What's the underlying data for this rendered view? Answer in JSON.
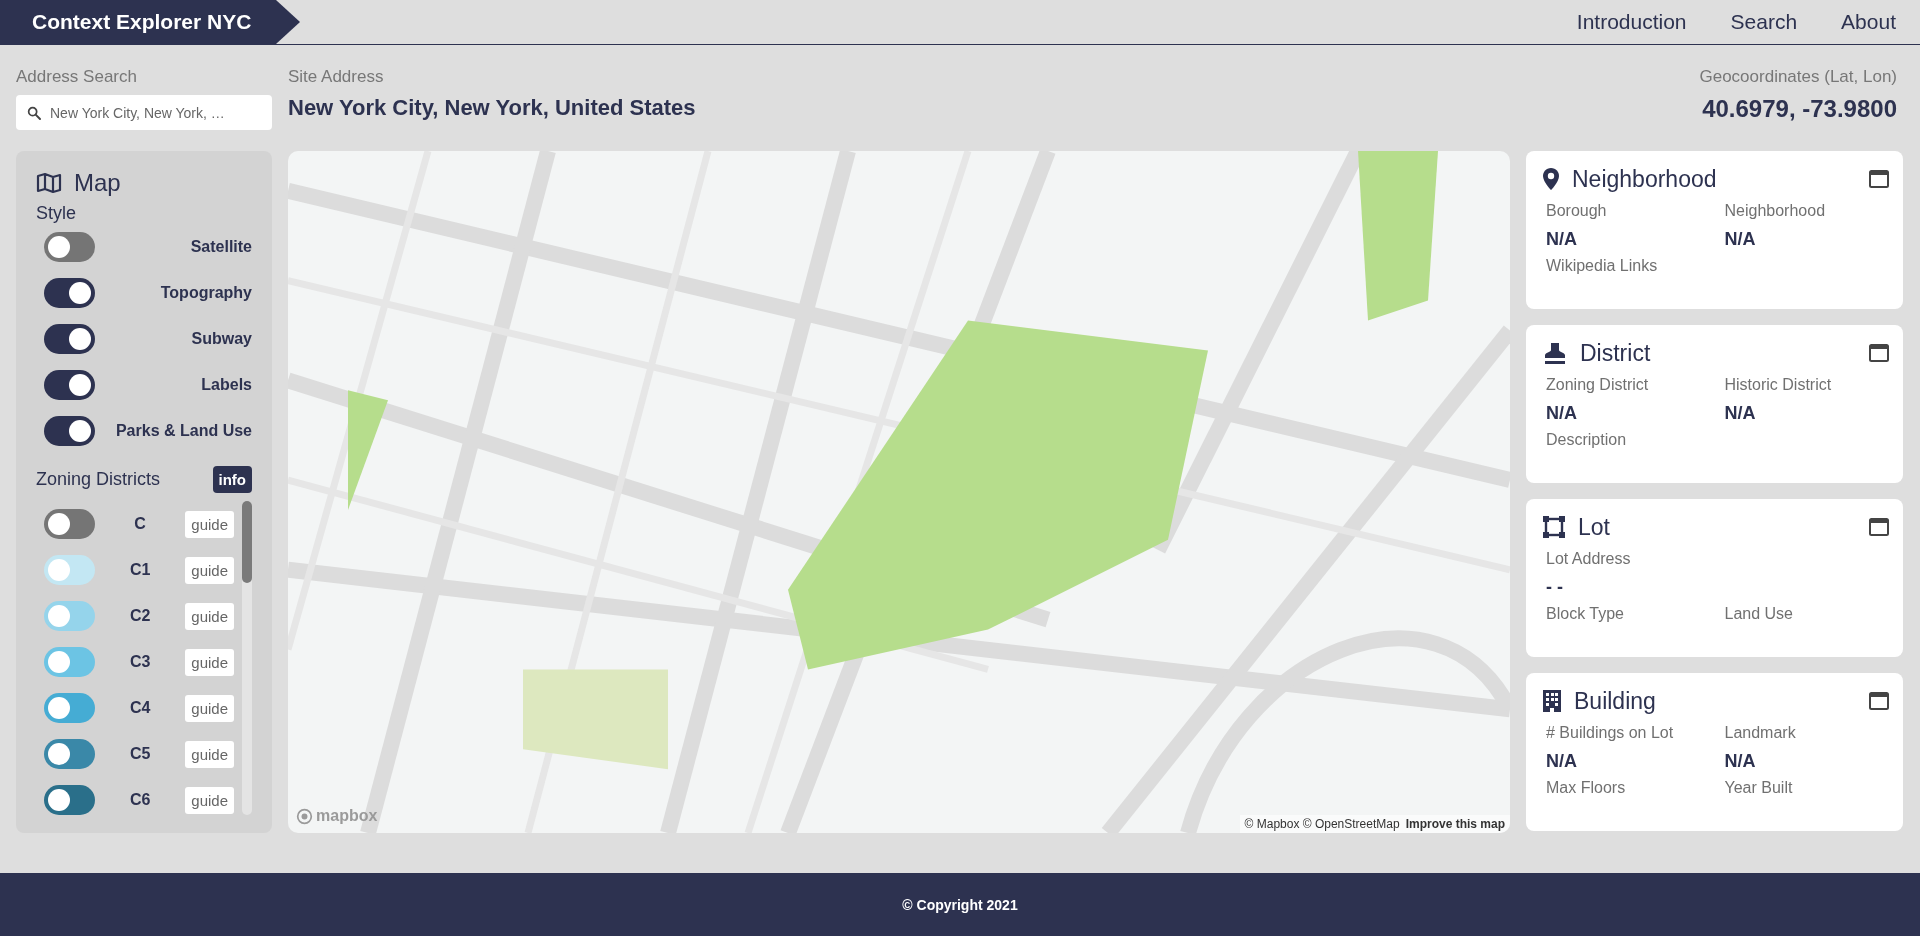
{
  "header": {
    "brand": "Context Explorer NYC",
    "nav": [
      {
        "label": "Introduction"
      },
      {
        "label": "Search"
      },
      {
        "label": "About"
      }
    ]
  },
  "address_search": {
    "label": "Address Search",
    "value": "New York City, New York, …"
  },
  "site_address": {
    "label": "Site Address",
    "value": "New York City, New York, United States"
  },
  "geocoordinates": {
    "label": "Geocoordinates (Lat, Lon)",
    "value": "40.6979, -73.9800"
  },
  "map_panel": {
    "title": "Map",
    "style_heading": "Style",
    "styles": [
      {
        "label": "Satellite",
        "on": false
      },
      {
        "label": "Topography",
        "on": true
      },
      {
        "label": "Subway",
        "on": true
      },
      {
        "label": "Labels",
        "on": true
      },
      {
        "label": "Parks & Land Use",
        "on": true
      }
    ],
    "zoning_heading": "Zoning Districts",
    "info_button": "info",
    "zoning": [
      {
        "code": "C",
        "on": false,
        "color": "#757575",
        "guide": "guide"
      },
      {
        "code": "C1",
        "on": false,
        "color": "#c3e7f3",
        "guide": "guide"
      },
      {
        "code": "C2",
        "on": false,
        "color": "#95d4eb",
        "guide": "guide"
      },
      {
        "code": "C3",
        "on": false,
        "color": "#6cc4e4",
        "guide": "guide"
      },
      {
        "code": "C4",
        "on": false,
        "color": "#45acd4",
        "guide": "guide"
      },
      {
        "code": "C5",
        "on": false,
        "color": "#3a88a8",
        "guide": "guide"
      },
      {
        "code": "C6",
        "on": false,
        "color": "#2a6f8a",
        "guide": "guide"
      }
    ]
  },
  "map": {
    "logo": "mapbox",
    "attribution": "© Mapbox © OpenStreetMap",
    "improve_link": "Improve this map"
  },
  "cards": [
    {
      "title": "Neighborhood",
      "rows": [
        [
          {
            "label": "Borough",
            "value": "N/A"
          },
          {
            "label": "Neighborhood",
            "value": "N/A"
          }
        ],
        [
          {
            "label": "Wikipedia Links"
          }
        ]
      ]
    },
    {
      "title": "District",
      "rows": [
        [
          {
            "label": "Zoning District",
            "value": "N/A"
          },
          {
            "label": "Historic District",
            "value": "N/A"
          }
        ],
        [
          {
            "label": "Description"
          }
        ]
      ]
    },
    {
      "title": "Lot",
      "rows": [
        [
          {
            "label": "Lot Address",
            "value": "- -"
          }
        ],
        [
          {
            "label": "Block Type"
          },
          {
            "label": "Land Use"
          }
        ]
      ]
    },
    {
      "title": "Building",
      "rows": [
        [
          {
            "label": "# Buildings on Lot",
            "value": "N/A"
          },
          {
            "label": "Landmark",
            "value": "N/A"
          }
        ],
        [
          {
            "label": "Max Floors"
          },
          {
            "label": "Year Built"
          }
        ]
      ]
    }
  ],
  "footer": {
    "copyright": "© Copyright 2021"
  }
}
